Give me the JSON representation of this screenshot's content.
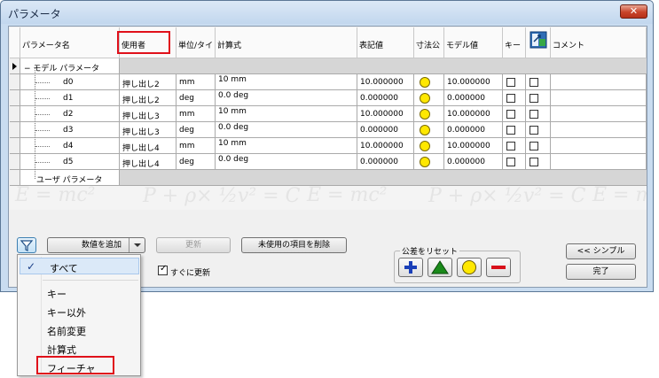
{
  "window": {
    "title": "パラメータ",
    "close_glyph": "✕"
  },
  "columns": [
    {
      "label": "パラメータ名"
    },
    {
      "label": "使用者"
    },
    {
      "label": "単位/タイ"
    },
    {
      "label": "計算式"
    },
    {
      "label": "表記値"
    },
    {
      "label": "寸法公"
    },
    {
      "label": "モデル値"
    },
    {
      "label": "キー"
    },
    {
      "label": ""
    },
    {
      "label": "コメント"
    }
  ],
  "group_model": {
    "expand_glyph": "−",
    "label": "モデル パラメータ"
  },
  "rows": [
    {
      "name": "d0",
      "used_by": "押し出し2",
      "unit": "mm",
      "expr": "10 mm",
      "nominal": "10.000000",
      "model": "10.000000"
    },
    {
      "name": "d1",
      "used_by": "押し出し2",
      "unit": "deg",
      "expr": "0.0 deg",
      "nominal": "0.000000",
      "model": "0.000000"
    },
    {
      "name": "d2",
      "used_by": "押し出し3",
      "unit": "mm",
      "expr": "10 mm",
      "nominal": "10.000000",
      "model": "10.000000"
    },
    {
      "name": "d3",
      "used_by": "押し出し3",
      "unit": "deg",
      "expr": "0.0 deg",
      "nominal": "0.000000",
      "model": "0.000000"
    },
    {
      "name": "d4",
      "used_by": "押し出し4",
      "unit": "mm",
      "expr": "10 mm",
      "nominal": "10.000000",
      "model": "10.000000"
    },
    {
      "name": "d5",
      "used_by": "押し出し4",
      "unit": "deg",
      "expr": "0.0 deg",
      "nominal": "0.000000",
      "model": "0.000000"
    }
  ],
  "group_user": {
    "label": "ユーザ パラメータ"
  },
  "watermark": {
    "left": "E = mc²",
    "bernoulli": "P + ρ× ½v² = C",
    "right": "E = mc²",
    "right2": "E = mc"
  },
  "toolbar": {
    "add_numeric": "数値を追加",
    "update": "更新",
    "purge_unused": "未使用の項目を削除",
    "immediate_update": "すぐに更新",
    "reset_tolerance": "公差をリセット",
    "simple": "<< シンプル",
    "done": "完了"
  },
  "filter_menu": {
    "items": [
      "すべて",
      "キー",
      "キー以外",
      "名前変更",
      "計算式",
      "フィーチャ"
    ],
    "checked_glyph": "✓"
  },
  "colors": {
    "highlight": "#e0101a",
    "tolerance_nominal": "#ffe800",
    "tolerance_upper": "#1a3fb8",
    "tolerance_lower": "#d8101a",
    "tolerance_median": "#1a8a1a"
  }
}
